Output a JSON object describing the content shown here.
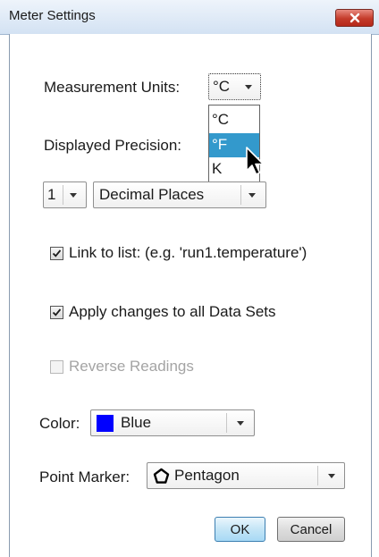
{
  "window": {
    "title": "Meter Settings",
    "close_icon": "close-icon"
  },
  "measurement_units": {
    "label": "Measurement Units:",
    "selected": "°C",
    "dropdown_open": true,
    "options": [
      "°C",
      "°F",
      "K"
    ],
    "highlighted_option": "°F"
  },
  "displayed_precision": {
    "label": "Displayed Precision:",
    "value": "1",
    "mode": "Decimal Places"
  },
  "link_to_list": {
    "label": "Link to list: (e.g. 'run1.temperature')",
    "checked": true
  },
  "apply_changes": {
    "label": "Apply changes to all Data Sets",
    "checked": true
  },
  "reverse_readings": {
    "label": "Reverse Readings",
    "checked": false,
    "enabled": false
  },
  "color": {
    "label": "Color:",
    "value": "Blue",
    "swatch": "#0000ff"
  },
  "point_marker": {
    "label": "Point Marker:",
    "value": "Pentagon",
    "icon": "pentagon-icon"
  },
  "buttons": {
    "ok": "OK",
    "cancel": "Cancel"
  },
  "colors": {
    "titlebar": "#d3e2f3",
    "close_button": "#c43b2a",
    "selection": "#3399cc"
  }
}
